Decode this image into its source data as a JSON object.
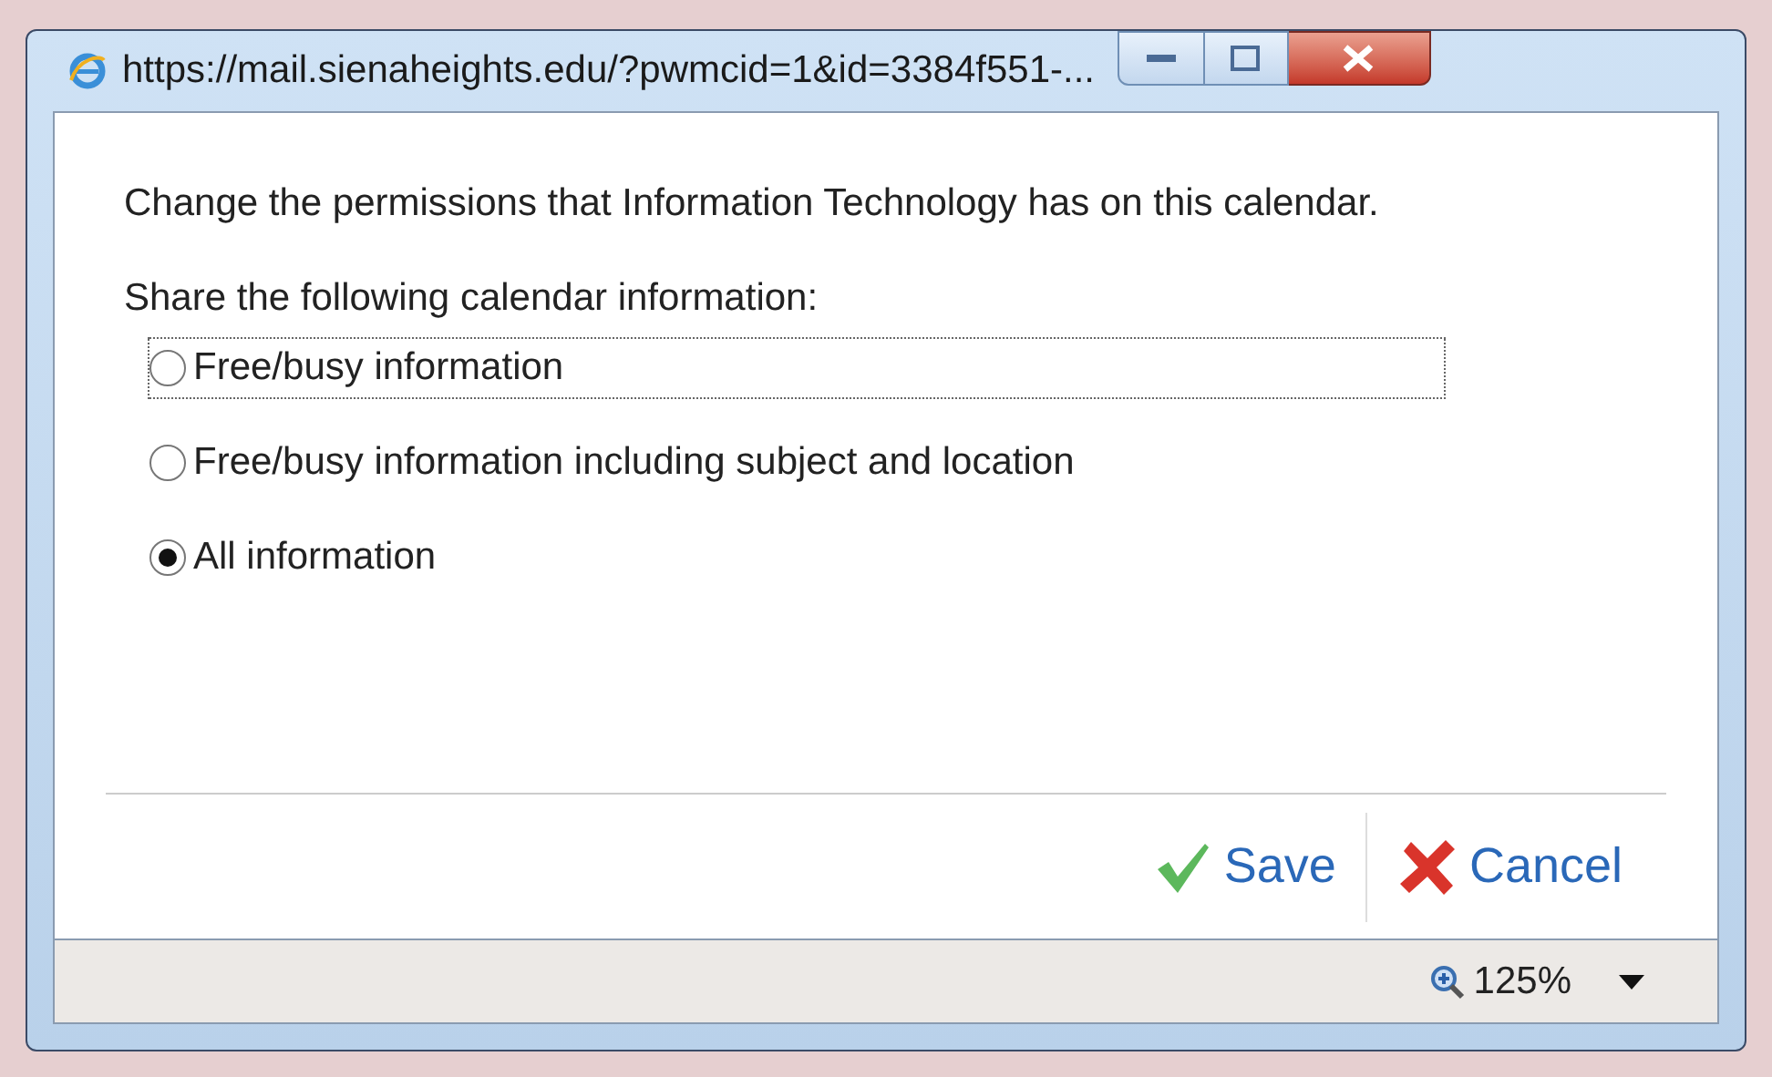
{
  "window": {
    "title": "https://mail.sienaheights.edu/?pwmcid=1&id=3384f551-..."
  },
  "message": "Change the permissions that Information Technology has on this calendar.",
  "share_label": "Share the following calendar information:",
  "options": [
    {
      "label": "Free/busy information",
      "selected": false,
      "focused": true
    },
    {
      "label": "Free/busy information including subject and location",
      "selected": false,
      "focused": false
    },
    {
      "label": "All information",
      "selected": true,
      "focused": false
    }
  ],
  "buttons": [
    {
      "kind": "save",
      "label": "Save"
    },
    {
      "kind": "cancel",
      "label": "Cancel"
    }
  ],
  "status_bar": {
    "zoom": "125%"
  }
}
